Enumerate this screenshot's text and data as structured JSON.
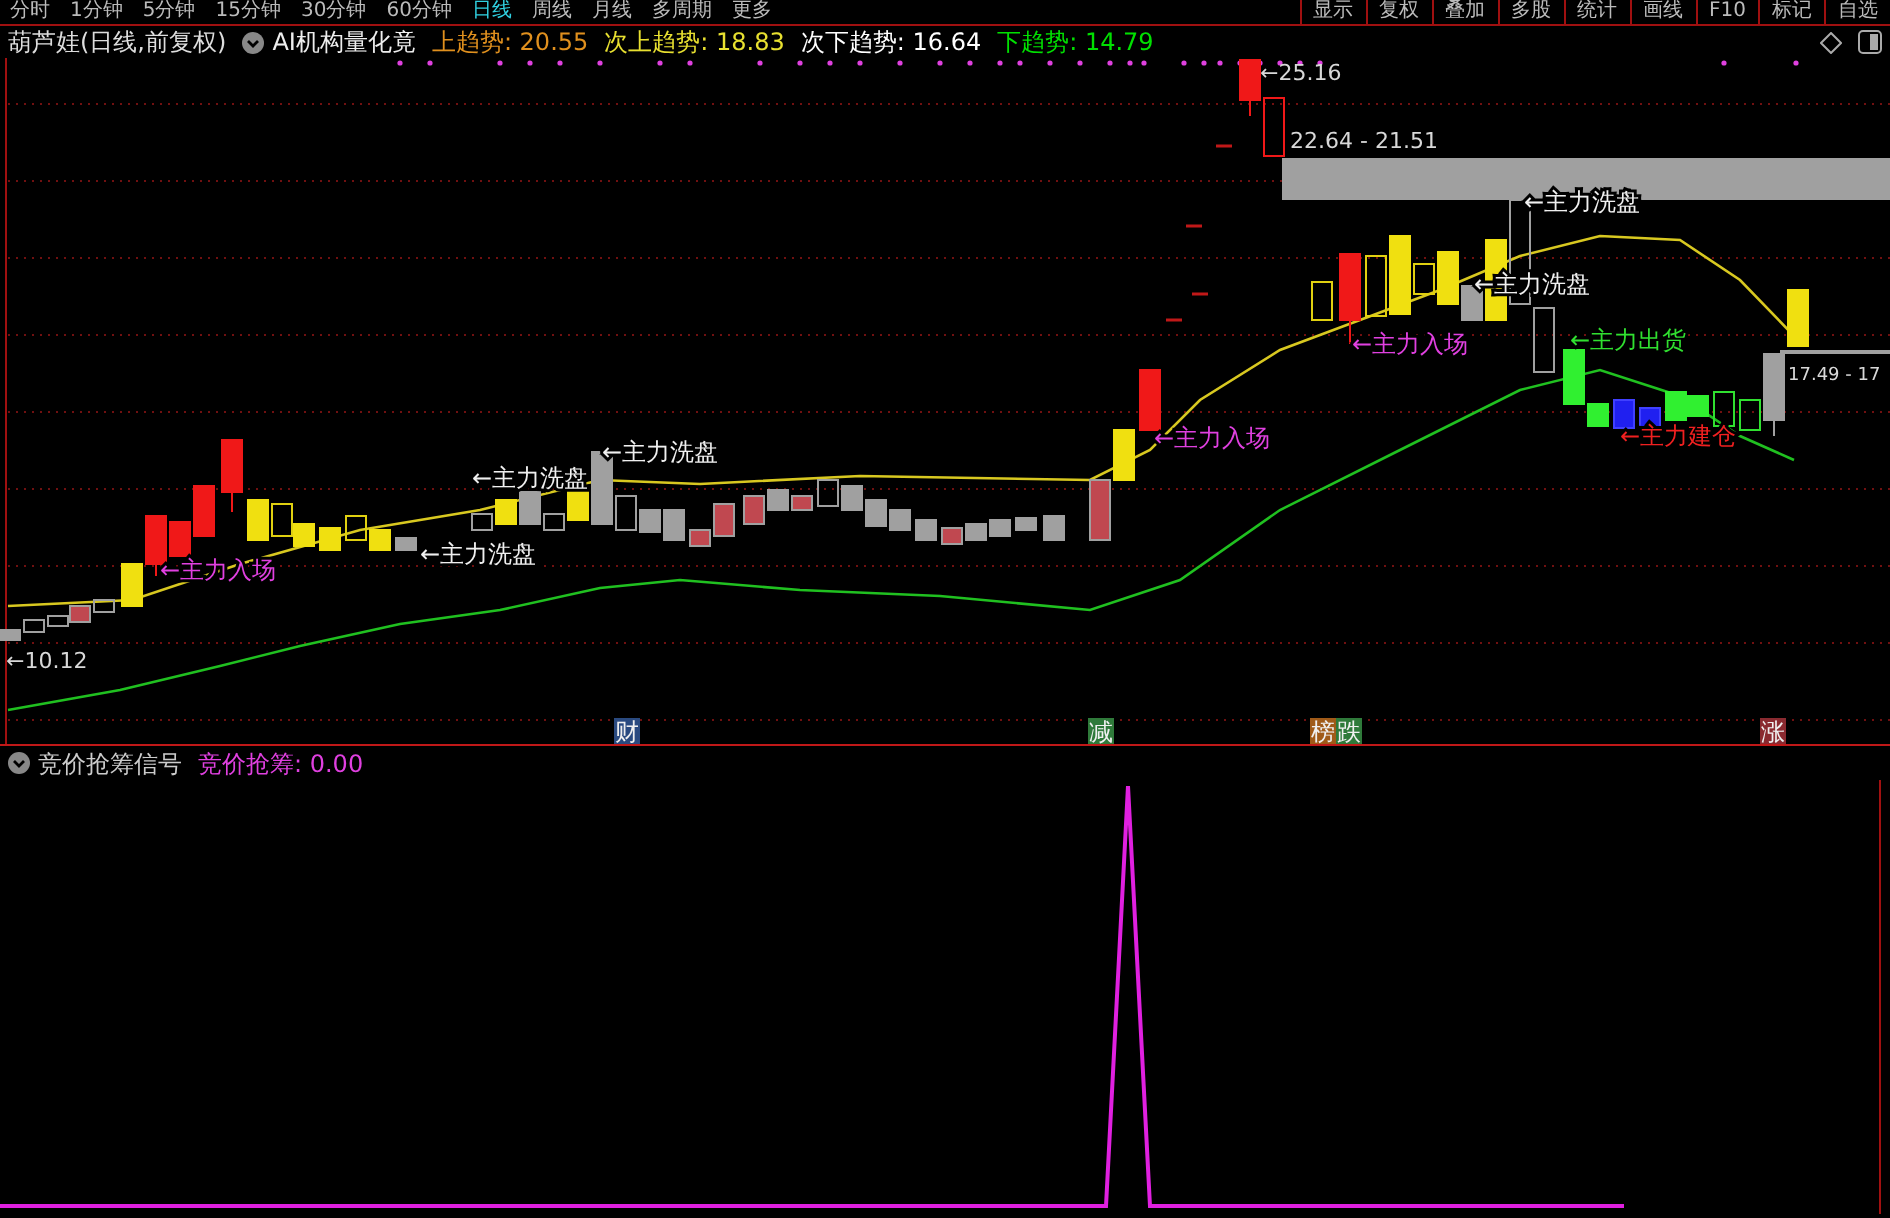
{
  "toolbar": {
    "periods": [
      {
        "label": "分时",
        "selected": false
      },
      {
        "label": "1分钟",
        "selected": false
      },
      {
        "label": "5分钟",
        "selected": false
      },
      {
        "label": "15分钟",
        "selected": false
      },
      {
        "label": "30分钟",
        "selected": false
      },
      {
        "label": "60分钟",
        "selected": false
      },
      {
        "label": "日线",
        "selected": true
      },
      {
        "label": "周线",
        "selected": false
      },
      {
        "label": "月线",
        "selected": false
      },
      {
        "label": "多周期",
        "selected": false
      },
      {
        "label": "更多",
        "selected": false
      }
    ],
    "buttons": [
      "显示",
      "复权",
      "叠加",
      "多股",
      "统计",
      "画线",
      "F10",
      "标记",
      "自选"
    ]
  },
  "main_panel": {
    "title": "葫芦娃(日线,前复权)",
    "indicator": "AI机构量化竟",
    "readouts": [
      {
        "text": "上趋势: 20.55",
        "color": "#e0901e"
      },
      {
        "text": "次上趋势: 18.83",
        "color": "#e8e030"
      },
      {
        "text": "次下趋势: 16.64",
        "color": "#ffffff"
      },
      {
        "text": "下趋势: 14.79",
        "color": "#00e000"
      }
    ],
    "price_labels": [
      "←25.16",
      "22.64 - 21.51",
      "17.49 - 17",
      "←10.12"
    ],
    "signals": [
      {
        "text": "←主力入场",
        "color": "#e040e0"
      },
      {
        "text": "←主力洗盘",
        "color": "#f0f0f0"
      },
      {
        "text": "←主力洗盘",
        "color": "#f0f0f0"
      },
      {
        "text": "←主力洗盘",
        "color": "#f0f0f0"
      },
      {
        "text": "←主力入场",
        "color": "#e040e0"
      },
      {
        "text": "←主力入场",
        "color": "#e040e0"
      },
      {
        "text": "←主力洗盘",
        "color": "#f0f0f0"
      },
      {
        "text": "←主力洗盘",
        "color": "#f0f0f0"
      },
      {
        "text": "←主力出货",
        "color": "#30e030"
      },
      {
        "text": "←主力建仓",
        "color": "#f02020"
      }
    ],
    "events": [
      {
        "text": "财",
        "color": "#2a4a80"
      },
      {
        "text": "减",
        "color": "#2f7a3a"
      },
      {
        "text": "榜",
        "color": "#a05a18"
      },
      {
        "text": "跌",
        "color": "#2f7a3a"
      },
      {
        "text": "涨",
        "color": "#8a2a30"
      }
    ]
  },
  "indicator_panel": {
    "title": "竞价抢筹信号",
    "readout": "竞价抢筹: 0.00"
  }
}
